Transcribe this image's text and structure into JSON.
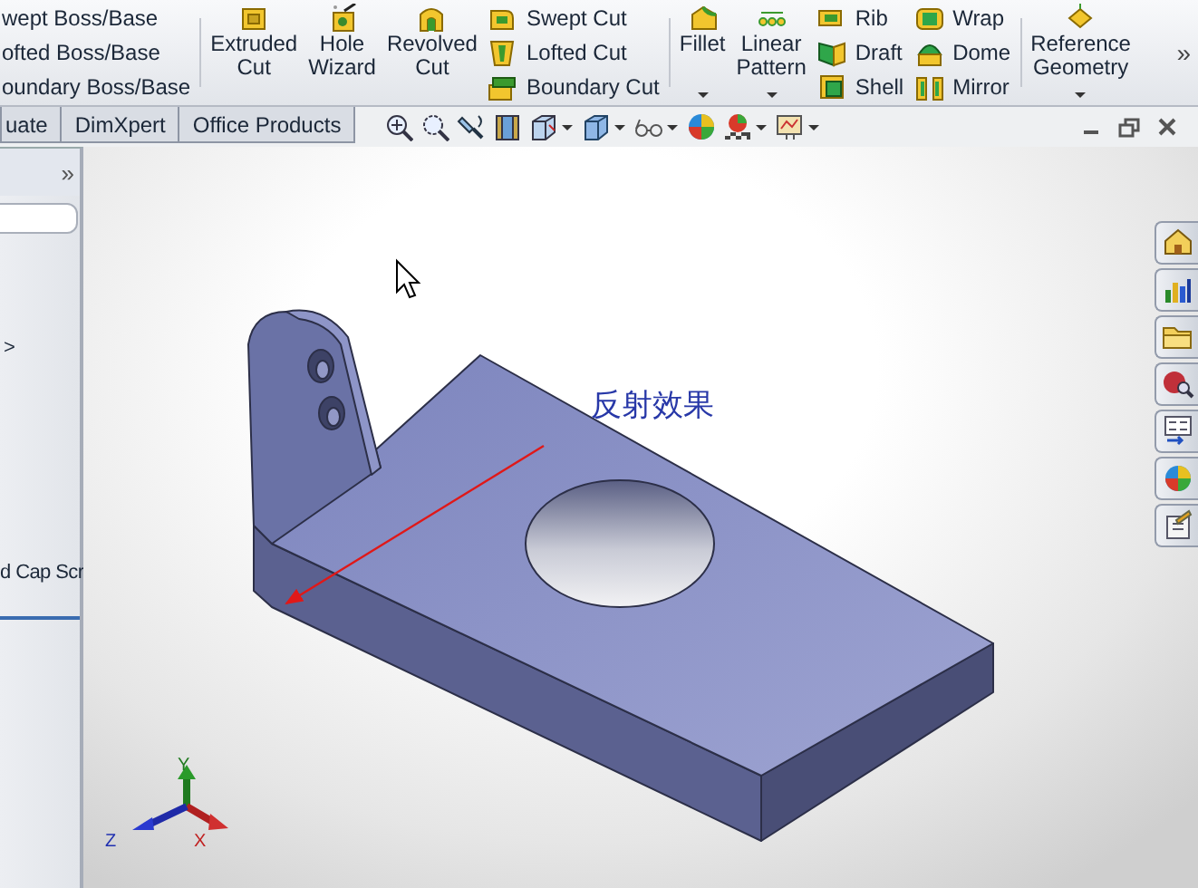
{
  "ribbon": {
    "boss_items": [
      {
        "label": "wept Boss/Base"
      },
      {
        "label": "ofted Boss/Base"
      },
      {
        "label": "oundary Boss/Base"
      }
    ],
    "cut_buttons": [
      {
        "label": "Extruded Cut",
        "dropdown": false
      },
      {
        "label": "Hole Wizard",
        "dropdown": false
      },
      {
        "label": "Revolved Cut",
        "dropdown": false
      }
    ],
    "cut_items": [
      {
        "label": "Swept Cut"
      },
      {
        "label": "Lofted Cut"
      },
      {
        "label": "Boundary Cut"
      }
    ],
    "feature_buttons": [
      {
        "label": "Fillet",
        "dropdown": true
      },
      {
        "label": "Linear Pattern",
        "dropdown": true
      }
    ],
    "feature_items": [
      {
        "label": "Rib"
      },
      {
        "label": "Draft"
      },
      {
        "label": "Shell"
      }
    ],
    "feature_items_2": [
      {
        "label": "Wrap"
      },
      {
        "label": "Dome"
      },
      {
        "label": "Mirror"
      }
    ],
    "reference_buttons": [
      {
        "label": "Reference Geometry",
        "dropdown": true
      }
    ],
    "overflow": "»"
  },
  "tabs": [
    {
      "label": "uate",
      "selected": false
    },
    {
      "label": "DimXpert",
      "selected": false
    },
    {
      "label": "Office Products",
      "selected": false
    }
  ],
  "view_toolbar": [
    {
      "dropdown": false
    },
    {
      "dropdown": false
    },
    {
      "dropdown": false
    },
    {
      "dropdown": false
    },
    {
      "dropdown": true
    },
    {
      "dropdown": true
    },
    {
      "dropdown": true
    },
    {
      "dropdown": false
    },
    {
      "dropdown": true
    },
    {
      "dropdown": true
    }
  ],
  "panel": {
    "expand": "»",
    "arrow": ">",
    "item": "d Cap Scr"
  },
  "annotation": {
    "text": "反射效果"
  },
  "triad": {
    "x": "X",
    "y": "Y",
    "z": "Z"
  }
}
